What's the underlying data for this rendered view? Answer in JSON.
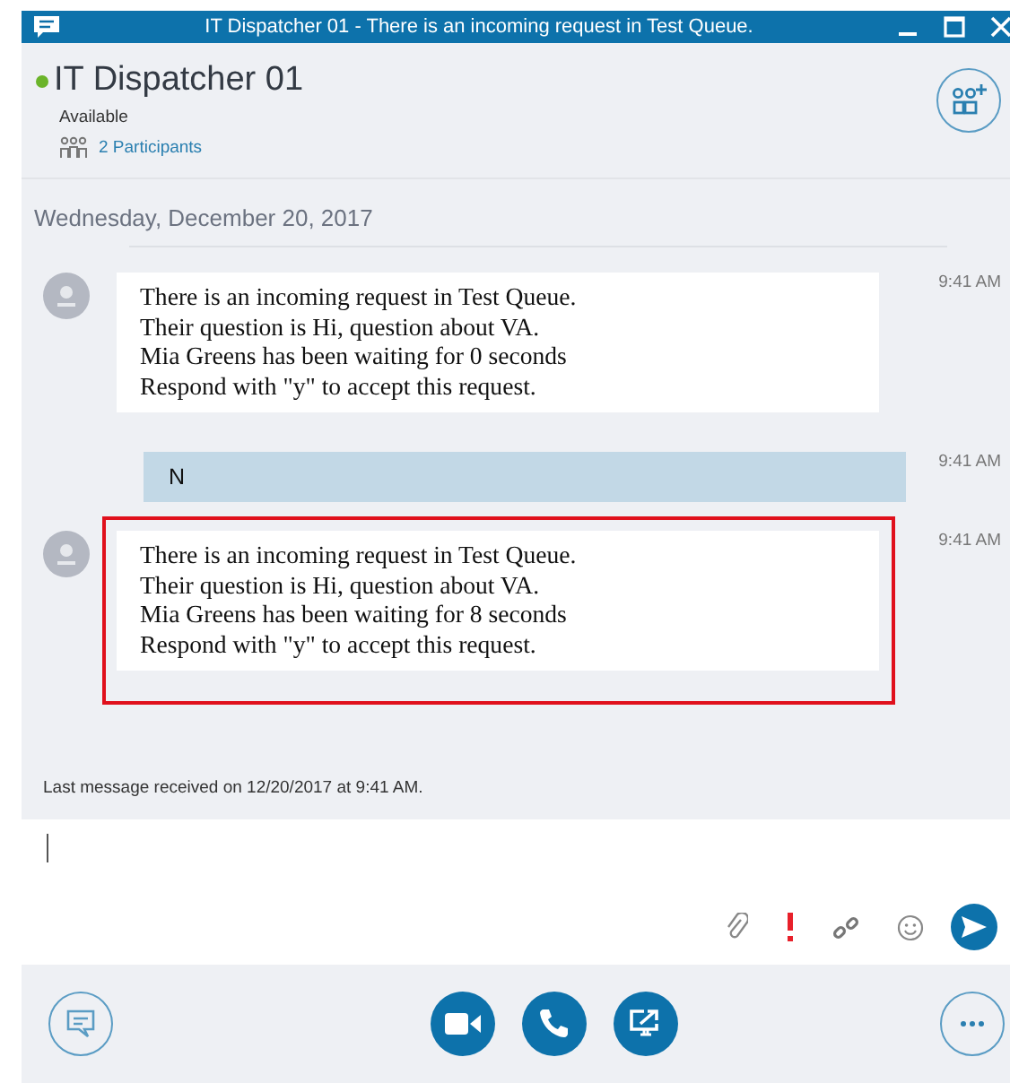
{
  "window": {
    "title": "IT Dispatcher 01 - There is an incoming request in Test Queue."
  },
  "contact": {
    "name": "IT Dispatcher 01",
    "status": "Available",
    "participants": "2 Participants"
  },
  "date_divider": "Wednesday, December 20, 2017",
  "messages": [
    {
      "kind": "incoming",
      "highlighted": false,
      "lines": [
        "There is an incoming request in Test Queue.",
        "Their question is Hi, question about VA.",
        "Mia Greens has been waiting for 0 seconds",
        "Respond with \"y\" to accept this request."
      ],
      "time": "9:41 AM"
    },
    {
      "kind": "outgoing",
      "highlighted": false,
      "lines": [
        "N"
      ],
      "time": "9:41 AM"
    },
    {
      "kind": "incoming",
      "highlighted": true,
      "lines": [
        "There is an incoming request in Test Queue.",
        "Their question is Hi, question about VA.",
        "Mia Greens has been waiting for 8 seconds",
        "Respond with \"y\" to accept this request."
      ],
      "time": "9:41 AM"
    }
  ],
  "last_message": "Last message received on 12/20/2017 at 9:41 AM.",
  "composer": {
    "important": true
  }
}
